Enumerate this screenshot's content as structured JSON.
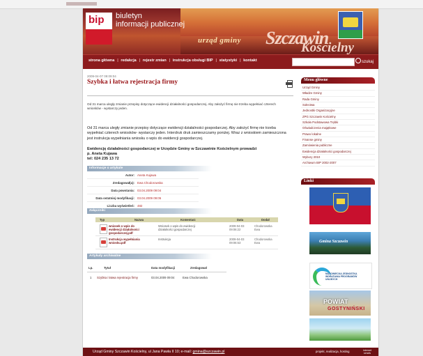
{
  "header": {
    "bip_logo": "bip",
    "bip_title_line1": "biuletyn",
    "bip_title_line2": "informacji publicznej",
    "urzad": "urząd gminy",
    "gmina_line1": "Szczawin",
    "gmina_line2": "Kościelny"
  },
  "nav": {
    "items": [
      "strona główna",
      "redakcja",
      "rejestr zmian",
      "instrukcja obsługi BIP",
      "statystyki",
      "kontakt"
    ],
    "separator": "|",
    "search_label": "szukaj"
  },
  "article": {
    "date": "2009-04-07 09:09:04",
    "title": "Szybka i łatwa rejestracja firmy",
    "intro": "Od 31 marca uległy zmianie przepisy dotyczące ewidencji działalności gospodarczej. Aby założyć firmę nie trzeba wypełniać czterech wniosków - wystarczy jeden.",
    "body": "Od 31 marca uległy zmianie przepisy dotyczące ewidencji działalności gospodarczej. Aby założyć firmę nie trzeba wypełniać czterech wniosków- wystarczy jeden. Interdruk druk zamieszczamy poniżej. Wraz z wnioskiem zamieszczona jest instrukcja wypełniania wniosku o wpis do ewidencji gospodarczej.",
    "ewid_line1": "Ewidencję działalności gospodarczej w Urzędzie Gminy w Szczawinie Kościelnym prowadzi",
    "ewid_line2": "p. Aneta Kujawa",
    "ewid_line3": "tel: 024 235 13 72"
  },
  "info": {
    "header": "Informacje o artykule",
    "rows": [
      {
        "label": "Autor:",
        "value": "Aneta Kujawa"
      },
      {
        "label": "Zredagował(a):",
        "value": "Ewa Chodorowska"
      },
      {
        "label": "Data powstania:",
        "value": "03.04.2009 09:04"
      },
      {
        "label": "Data ostatniej modyfikacji:",
        "value": "03.04.2009 09:05"
      },
      {
        "label": "Liczba wyświetleń:",
        "value": "482"
      }
    ]
  },
  "attachments": {
    "header": "Załączniki",
    "columns": [
      "Typ",
      "Nazwa",
      "Komentarz",
      "Data",
      "Dodał"
    ],
    "rows": [
      {
        "name": "wniosek o wpis do ewidencji działalności gospodarczej.pdf",
        "comment": "Wniosek o wpis do ewidencji działalności gospodarczej",
        "date": "2009-04-03 09:06:22",
        "by": "Chodorowska Ewa"
      },
      {
        "name": "Instrukcja wypełniania wniosku.pdf",
        "comment": "Instrukcja",
        "date": "2009-04-03 09:06:53",
        "by": "Chodorowska Ewa"
      }
    ]
  },
  "archive": {
    "header": "Artykuły archiwalne",
    "columns": [
      "Lp.",
      "Tytuł",
      "Data modyfikacji",
      "Zredagował"
    ],
    "rows": [
      {
        "lp": "1",
        "title": "Szybka i łatwa rejestracja firmy",
        "date": "03.04.2009 09:04",
        "editor": "Ewa Chodorowska"
      }
    ]
  },
  "sidebar": {
    "menu_header": "Menu główne",
    "menu_items": [
      "Urząd Gminy",
      "Władze Gminy",
      "Rada Gminy",
      "Sołectwa",
      "Jednostki Organizacyjne",
      "ZPG Szczawin Kościelny",
      "Szkoła Podstawowa Trębki",
      "Oświadczenia majątkowe",
      "Prawo lokalne",
      "Finanse gminy",
      "Zamówienia publiczne",
      "Ewidencja działalności gospodarczej",
      "Wybory 2010",
      "Archiwum BIP 2002-2007"
    ],
    "links_header": "Linki",
    "banner2_text": "Gmina Szczawin",
    "banner3_text": "MAZOWIECKA JEDNOSTKA WDRAŻANIA PROGRAMÓW UNIJNYCH",
    "banner4_line1": "POWIAT",
    "banner4_line2": "GOSTYNIŃSKI"
  },
  "footer": {
    "address": "Urząd Gminy Szczawin Kościelny, ul Jana Pawła II 10; e-mail: ",
    "email": "gmina@szczawin.pl",
    "credits": "projekt, realizacja, hosting",
    "company": "internet serwis"
  },
  "colors": {
    "brand_dark": "#6d1114",
    "brand_red": "#8c1b1d",
    "title_red": "#9a1518"
  }
}
